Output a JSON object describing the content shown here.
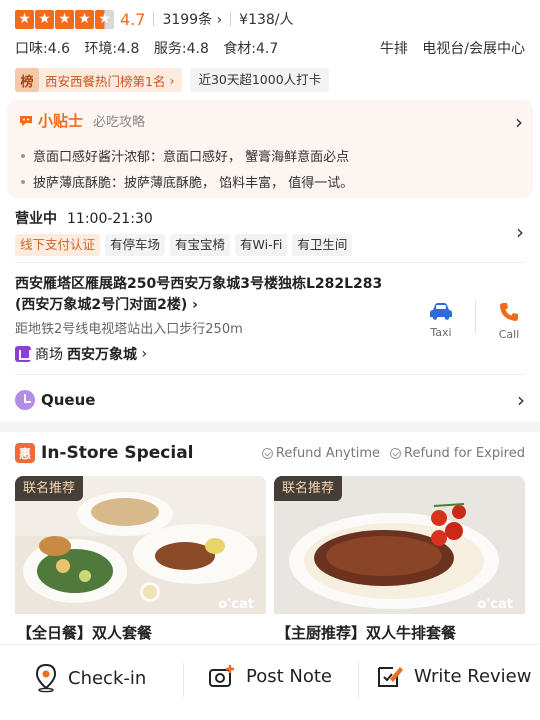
{
  "header": {
    "rating_score": "4.7",
    "rating_value": 4.7,
    "reviews": "3199条",
    "price": "¥138/人",
    "scores": [
      "口味:4.6",
      "环境:4.8",
      "服务:4.8",
      "食材:4.7"
    ],
    "tags": [
      "牛排",
      "电视台/会展中心"
    ]
  },
  "rank": {
    "badge": "榜",
    "label": "西安西餐热门榜第1名",
    "checkin": "近30天超1000人打卡"
  },
  "tips": {
    "title": "小贴士",
    "subtitle": "必吃攻略",
    "items": [
      "意面口感好酱汁浓郁：意面口感好， 蟹膏海鲜意面必点",
      "披萨薄底酥脆：披萨薄底酥脆， 馅料丰富， 值得一试。"
    ]
  },
  "hours": {
    "status": "营业中",
    "time": "11:00-21:30",
    "amenities": [
      "线下支付认证",
      "有停车场",
      "有宝宝椅",
      "有Wi-Fi",
      "有卫生间"
    ]
  },
  "address": {
    "line1": "西安雁塔区雁展路250号西安万象城3号楼独栋L282L283",
    "line2": "(西安万象城2号门对面2楼)",
    "distance": "距地铁2号线电视塔站出入口步行250m",
    "mall_prefix": "商场",
    "mall_name": "西安万象城",
    "taxi_label": "Taxi",
    "call_label": "Call"
  },
  "queue": {
    "label": "Queue"
  },
  "special": {
    "icon": "惠",
    "title": "In-Store Special",
    "refund_anytime": "Refund Anytime",
    "refund_expired": "Refund for Expired",
    "cards": [
      {
        "tag": "联名推荐",
        "brand": "o'cat",
        "name": "【全日餐】双人套餐"
      },
      {
        "tag": "联名推荐",
        "brand": "o'cat",
        "name": "【主厨推荐】双人牛排套餐"
      }
    ]
  },
  "bottombar": {
    "checkin": "Check-in",
    "post_note": "Post Note",
    "write_review": "Write Review"
  },
  "colors": {
    "accent": "#f26b1d",
    "purple": "#8b3fd6",
    "taxi_blue": "#2f6bd9"
  }
}
